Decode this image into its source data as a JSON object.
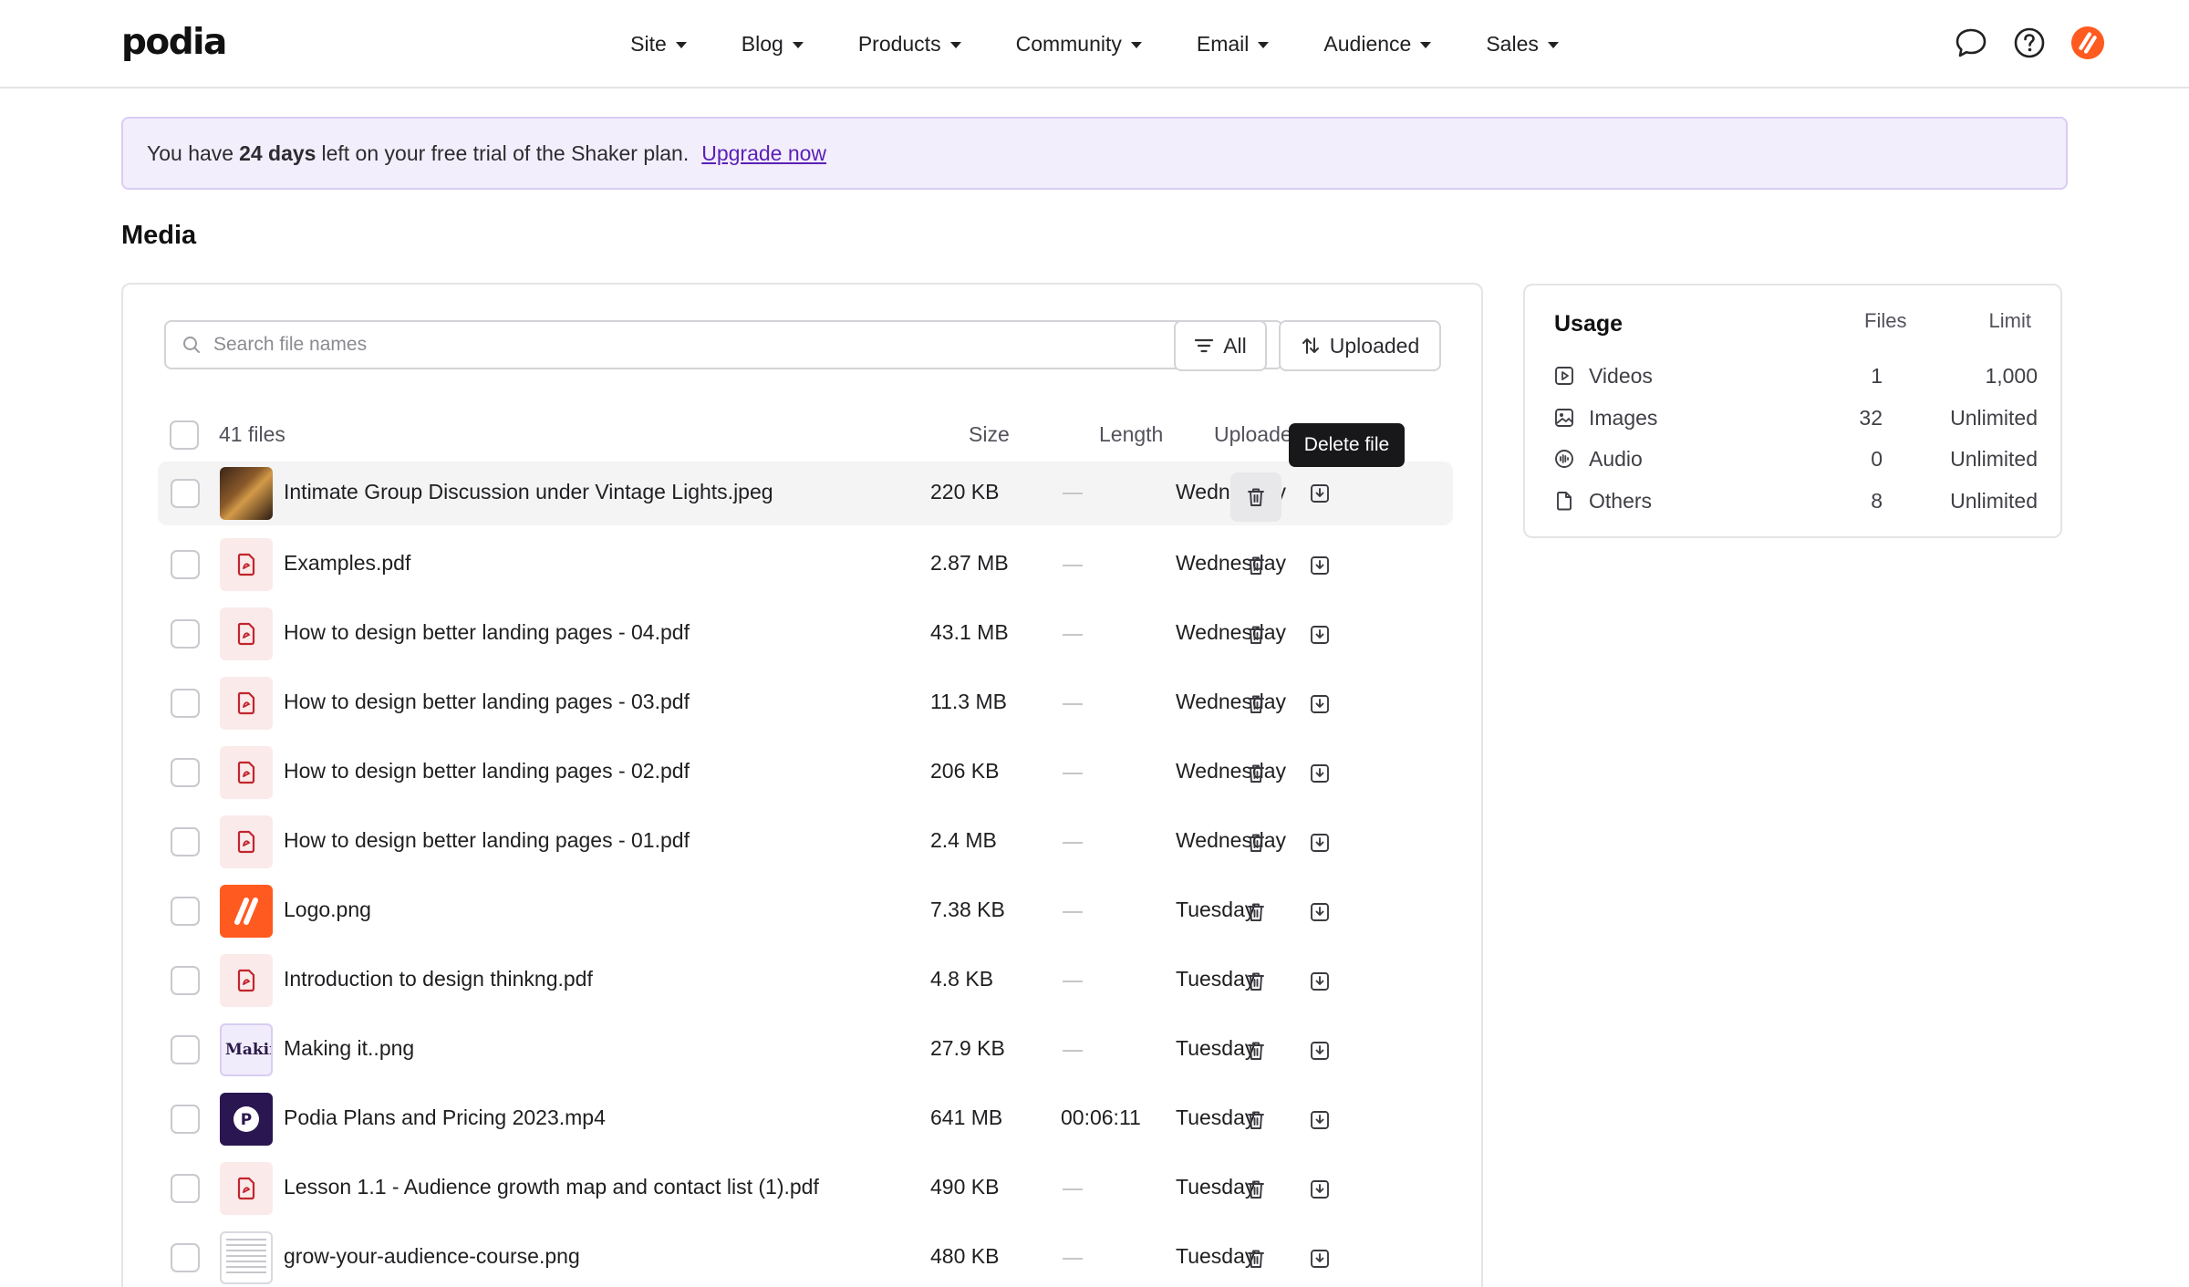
{
  "app": {
    "logo": "podia"
  },
  "nav": {
    "items": [
      {
        "label": "Site"
      },
      {
        "label": "Blog"
      },
      {
        "label": "Products"
      },
      {
        "label": "Community"
      },
      {
        "label": "Email"
      },
      {
        "label": "Audience"
      },
      {
        "label": "Sales"
      }
    ],
    "icons": [
      "chat-icon",
      "help-icon",
      "avatar"
    ]
  },
  "banner": {
    "prefix": "You have",
    "days": "24 days",
    "suffix": "left on your free trial of the Shaker plan.",
    "link": "Upgrade now"
  },
  "page": {
    "title": "Media"
  },
  "toolbar": {
    "search_placeholder": "Search file names",
    "filter_label": "All",
    "sort_label": "Uploaded"
  },
  "table": {
    "file_count": "41 files",
    "columns": {
      "size": "Size",
      "length": "Length",
      "uploaded": "Uploaded"
    },
    "tooltip": "Delete file",
    "rows": [
      {
        "name": "Intimate Group Discussion under Vintage Lights.jpeg",
        "size": "220 KB",
        "length": "",
        "uploaded": "Wednesday",
        "thumb": "photo"
      },
      {
        "name": "Examples.pdf",
        "size": "2.87 MB",
        "length": "",
        "uploaded": "Wednesday",
        "thumb": "pdf"
      },
      {
        "name": "How to design better landing pages - 04.pdf",
        "size": "43.1 MB",
        "length": "",
        "uploaded": "Wednesday",
        "thumb": "pdf"
      },
      {
        "name": "How to design better landing pages - 03.pdf",
        "size": "11.3 MB",
        "length": "",
        "uploaded": "Wednesday",
        "thumb": "pdf"
      },
      {
        "name": "How to design better landing pages - 02.pdf",
        "size": "206 KB",
        "length": "",
        "uploaded": "Wednesday",
        "thumb": "pdf"
      },
      {
        "name": "How to design better landing pages - 01.pdf",
        "size": "2.4 MB",
        "length": "",
        "uploaded": "Wednesday",
        "thumb": "pdf"
      },
      {
        "name": "Logo.png",
        "size": "7.38 KB",
        "length": "",
        "uploaded": "Tuesday",
        "thumb": "logo"
      },
      {
        "name": "Introduction to design thinkng.pdf",
        "size": "4.8 KB",
        "length": "",
        "uploaded": "Tuesday",
        "thumb": "pdf"
      },
      {
        "name": "Making it..png",
        "size": "27.9 KB",
        "length": "",
        "uploaded": "Tuesday",
        "thumb": "making",
        "thumb_text": "Makin"
      },
      {
        "name": "Podia Plans and Pricing 2023.mp4",
        "size": "641 MB",
        "length": "00:06:11",
        "uploaded": "Tuesday",
        "thumb": "video"
      },
      {
        "name": "Lesson 1.1 - Audience growth map and contact list (1).pdf",
        "size": "490 KB",
        "length": "",
        "uploaded": "Tuesday",
        "thumb": "pdf"
      },
      {
        "name": "grow-your-audience-course.png",
        "size": "480 KB",
        "length": "",
        "uploaded": "Tuesday",
        "thumb": "doc"
      }
    ]
  },
  "usage": {
    "title": "Usage",
    "columns": {
      "files": "Files",
      "limit": "Limit"
    },
    "rows": [
      {
        "label": "Videos",
        "files": "1",
        "limit": "1,000",
        "icon": "video-icon"
      },
      {
        "label": "Images",
        "files": "32",
        "limit": "Unlimited",
        "icon": "image-icon"
      },
      {
        "label": "Audio",
        "files": "0",
        "limit": "Unlimited",
        "icon": "audio-icon"
      },
      {
        "label": "Others",
        "files": "8",
        "limit": "Unlimited",
        "icon": "file-icon"
      }
    ]
  },
  "colors": {
    "accent": "#5b21b6",
    "banner_bg": "#f3eefc",
    "pdf_icon": "#c0262d",
    "brand_orange": "#ff5a1f"
  }
}
